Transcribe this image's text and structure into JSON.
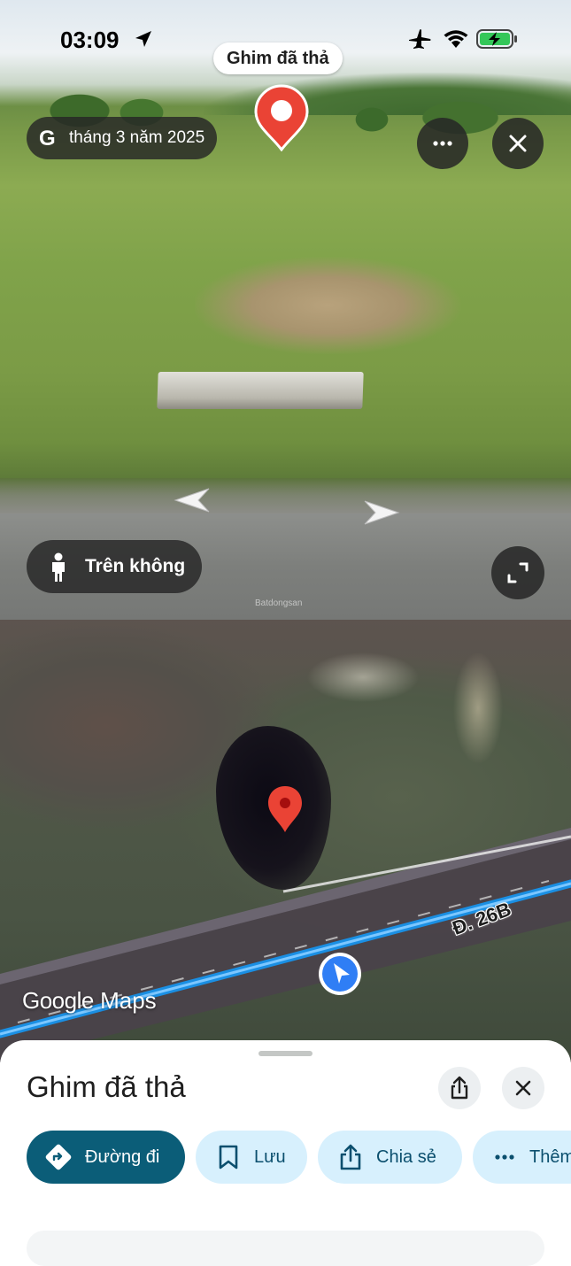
{
  "status_bar": {
    "time": "03:09"
  },
  "street_view": {
    "pin_label": "Ghim đã thả",
    "date": "tháng 3 năm 2025",
    "google_g": "G",
    "aerial_label": "Trên không",
    "watermark": "Batdongsan"
  },
  "map": {
    "road_label": "Đ. 26B",
    "logo_google": "Google",
    "logo_maps": "Maps"
  },
  "sheet": {
    "title": "Ghim đã thả",
    "actions": [
      {
        "label": "Đường đi",
        "icon": "directions-icon"
      },
      {
        "label": "Lưu",
        "icon": "bookmark-icon"
      },
      {
        "label": "Chia sẻ",
        "icon": "share-icon"
      },
      {
        "label": "Thêm",
        "icon": "more-horizontal-icon"
      }
    ]
  },
  "colors": {
    "pin_red": "#ea4335",
    "primary_button": "#0b5d78",
    "tonal_button": "#d7f0fd",
    "route_blue": "#1a8fe3"
  }
}
